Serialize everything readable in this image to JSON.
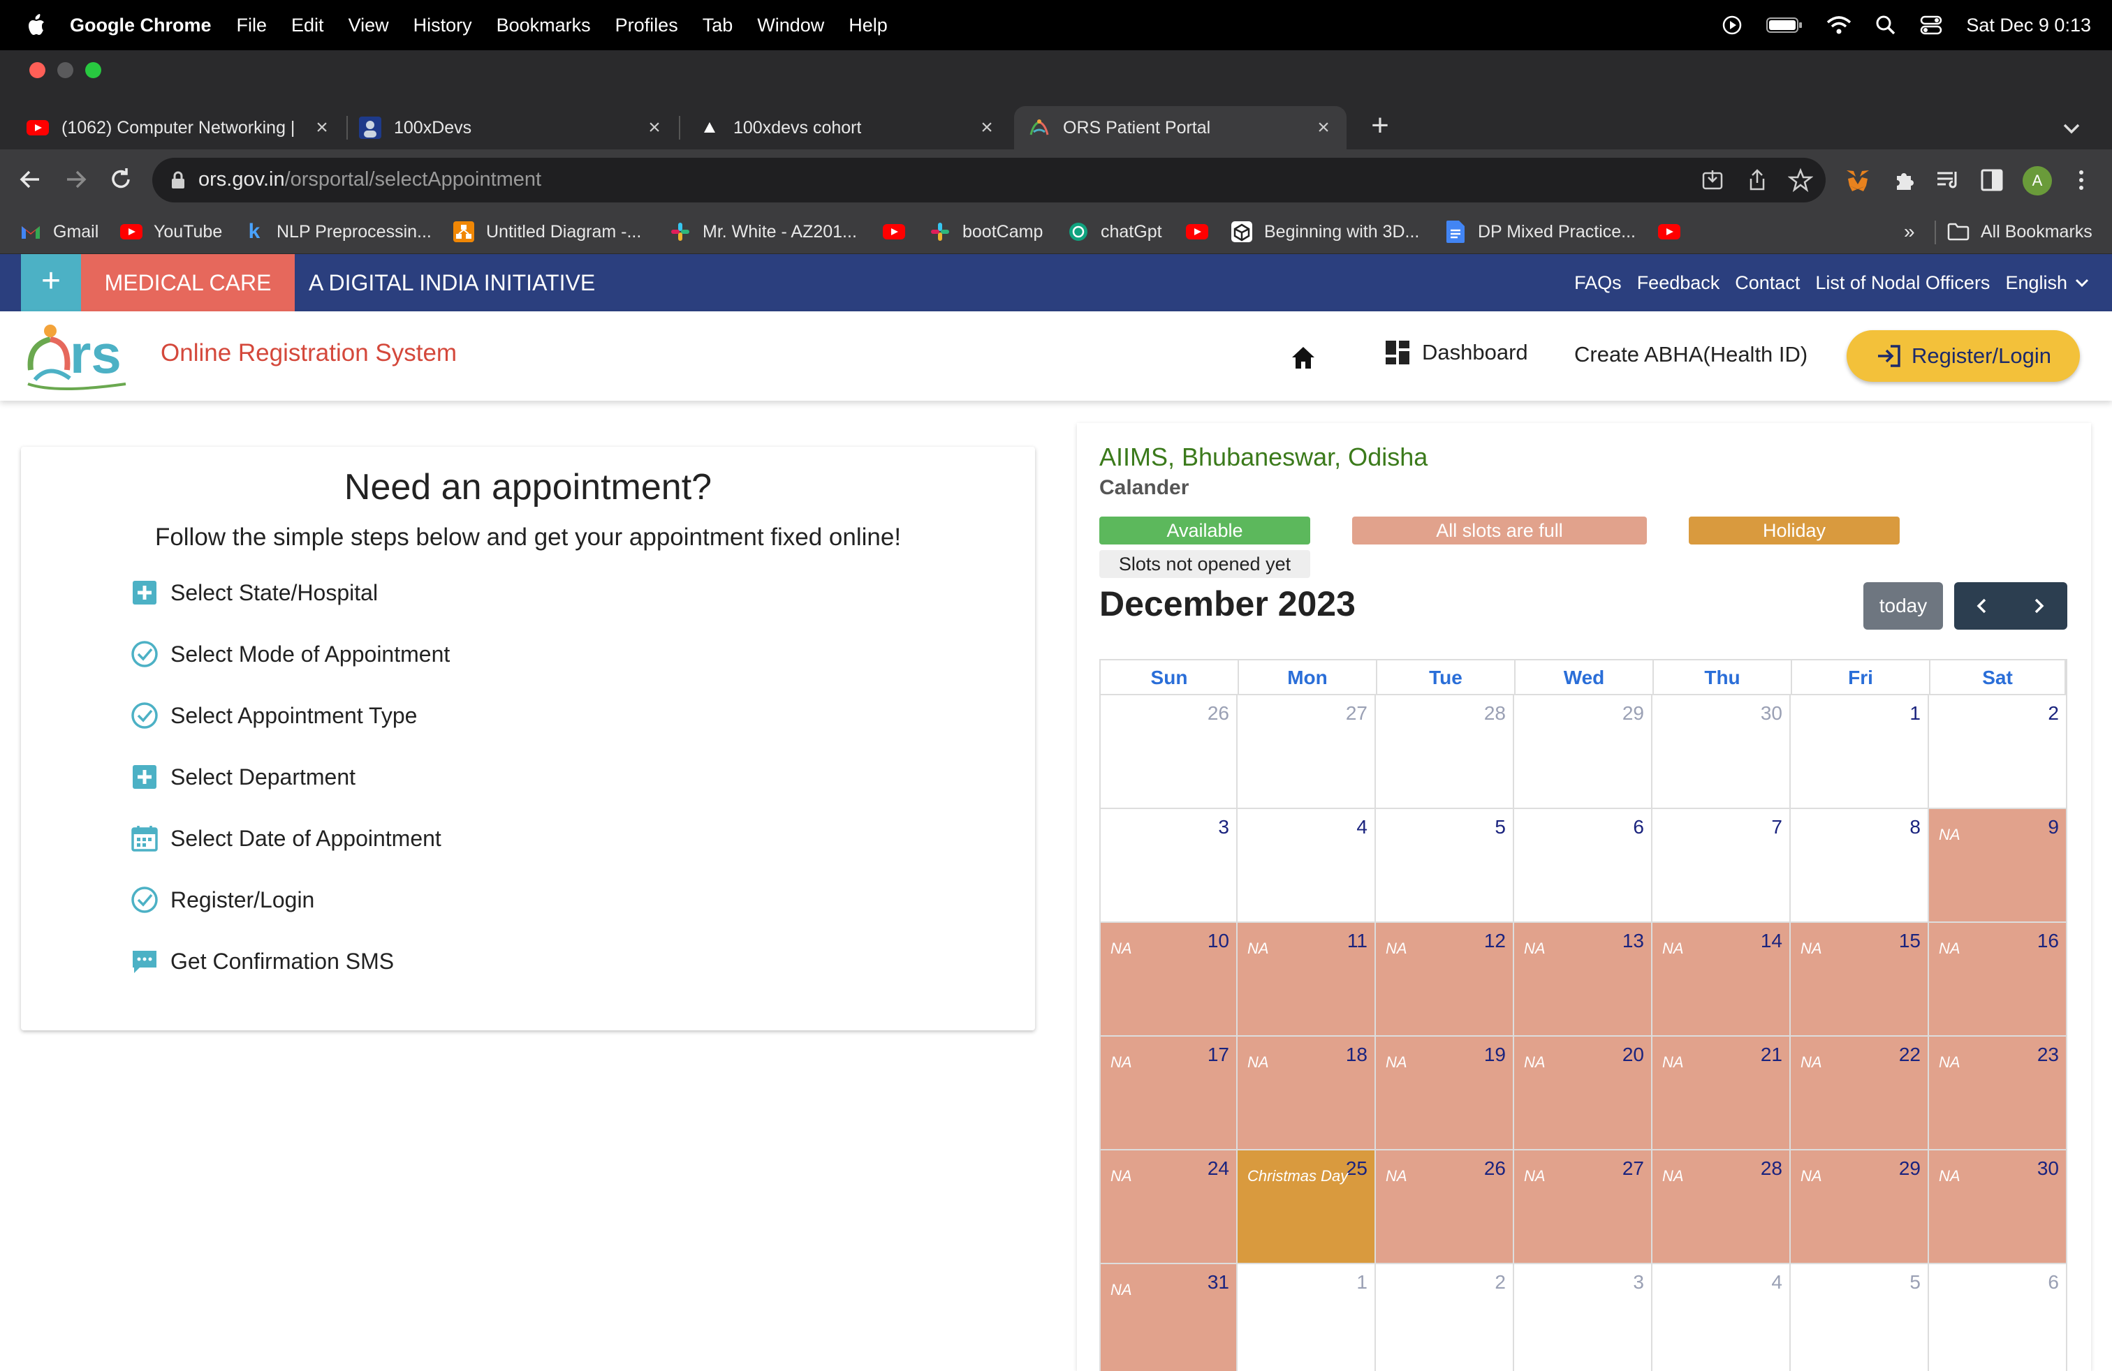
{
  "os_menubar": {
    "app_name": "Google Chrome",
    "menus": [
      "File",
      "Edit",
      "View",
      "History",
      "Bookmarks",
      "Profiles",
      "Tab",
      "Window",
      "Help"
    ],
    "clock": "Sat Dec 9  0:13"
  },
  "browser": {
    "tabs": [
      {
        "title": "(1062) Computer Networking |",
        "icon": "youtube-icon"
      },
      {
        "title": "100xDevs",
        "icon": "avatar-icon"
      },
      {
        "title": "100xdevs cohort",
        "icon": "triangle-icon"
      },
      {
        "title": "ORS Patient Portal",
        "icon": "ors-icon"
      }
    ],
    "url_host": "ors.gov.in",
    "url_path": "/orsportal/selectAppointment",
    "profile_initial": "A",
    "bookmarks": [
      {
        "label": "Gmail",
        "icon": "gmail-icon"
      },
      {
        "label": "YouTube",
        "icon": "youtube-icon"
      },
      {
        "label": "NLP Preprocessin...",
        "icon": "k-icon"
      },
      {
        "label": "Untitled Diagram -...",
        "icon": "drawio-icon"
      },
      {
        "label": "Mr. White - AZ201...",
        "icon": "slack-icon"
      },
      {
        "label": "",
        "icon": "youtube-icon"
      },
      {
        "label": "bootCamp",
        "icon": "slack-icon"
      },
      {
        "label": "chatGpt",
        "icon": "chatgpt-icon"
      },
      {
        "label": "",
        "icon": "youtube-icon"
      },
      {
        "label": "Beginning with 3D...",
        "icon": "unity-icon"
      },
      {
        "label": "DP Mixed Practice...",
        "icon": "docs-icon"
      },
      {
        "label": "",
        "icon": "youtube-icon"
      }
    ],
    "bookmarks_overflow": "»",
    "all_bookmarks": "All Bookmarks"
  },
  "site": {
    "topbar": {
      "plus": "+",
      "medical_care": "MEDICAL CARE",
      "initiative": "A DIGITAL INDIA INITIATIVE",
      "links": [
        "FAQs",
        "Feedback",
        "Contact",
        "List of Nodal Officers"
      ],
      "language": "English"
    },
    "header": {
      "brand": "Online Registration System",
      "dashboard": "Dashboard",
      "abha": "Create ABHA(Health ID)",
      "register_login": "Register/Login"
    },
    "appointment_card": {
      "title": "Need an appointment?",
      "subtitle": "Follow the simple steps below and get your appointment fixed online!",
      "steps": [
        {
          "label": "Select State/Hospital",
          "icon": "plus-square-icon"
        },
        {
          "label": "Select Mode of Appointment",
          "icon": "check-circle-icon"
        },
        {
          "label": "Select Appointment Type",
          "icon": "check-circle-icon"
        },
        {
          "label": "Select Department",
          "icon": "plus-square-icon"
        },
        {
          "label": "Select Date of Appointment",
          "icon": "calendar-icon"
        },
        {
          "label": "Register/Login",
          "icon": "check-circle-icon"
        },
        {
          "label": "Get Confirmation SMS",
          "icon": "sms-icon"
        }
      ]
    },
    "calendar": {
      "hospital": "AIIMS, Bhubaneswar, Odisha",
      "caption": "Calander",
      "legend": [
        {
          "label": "Available",
          "color": "#5cb85c"
        },
        {
          "label": "All slots are full",
          "color": "#e1a28c"
        },
        {
          "label": "Holiday",
          "color": "#d99a3e"
        },
        {
          "label": "Slots not opened yet",
          "color": "#eeeeee"
        }
      ],
      "month_title": "December 2023",
      "today": "today",
      "weekdays": [
        "Sun",
        "Mon",
        "Tue",
        "Wed",
        "Thu",
        "Fri",
        "Sat"
      ],
      "na_label": "NA",
      "weeks": [
        [
          {
            "d": "26",
            "s": "other"
          },
          {
            "d": "27",
            "s": "other"
          },
          {
            "d": "28",
            "s": "other"
          },
          {
            "d": "29",
            "s": "other"
          },
          {
            "d": "30",
            "s": "other"
          },
          {
            "d": "1",
            "s": "open"
          },
          {
            "d": "2",
            "s": "open"
          }
        ],
        [
          {
            "d": "3",
            "s": "open"
          },
          {
            "d": "4",
            "s": "open"
          },
          {
            "d": "5",
            "s": "open"
          },
          {
            "d": "6",
            "s": "open"
          },
          {
            "d": "7",
            "s": "open"
          },
          {
            "d": "8",
            "s": "open"
          },
          {
            "d": "9",
            "s": "full"
          }
        ],
        [
          {
            "d": "10",
            "s": "full"
          },
          {
            "d": "11",
            "s": "full"
          },
          {
            "d": "12",
            "s": "full"
          },
          {
            "d": "13",
            "s": "full"
          },
          {
            "d": "14",
            "s": "full"
          },
          {
            "d": "15",
            "s": "full"
          },
          {
            "d": "16",
            "s": "full"
          }
        ],
        [
          {
            "d": "17",
            "s": "full"
          },
          {
            "d": "18",
            "s": "full"
          },
          {
            "d": "19",
            "s": "full"
          },
          {
            "d": "20",
            "s": "full"
          },
          {
            "d": "21",
            "s": "full"
          },
          {
            "d": "22",
            "s": "full"
          },
          {
            "d": "23",
            "s": "full"
          }
        ],
        [
          {
            "d": "24",
            "s": "full"
          },
          {
            "d": "25",
            "s": "holiday",
            "label": "Christmas Day"
          },
          {
            "d": "26",
            "s": "full"
          },
          {
            "d": "27",
            "s": "full"
          },
          {
            "d": "28",
            "s": "full"
          },
          {
            "d": "29",
            "s": "full"
          },
          {
            "d": "30",
            "s": "full"
          }
        ],
        [
          {
            "d": "31",
            "s": "full"
          },
          {
            "d": "1",
            "s": "other"
          },
          {
            "d": "2",
            "s": "other"
          },
          {
            "d": "3",
            "s": "other"
          },
          {
            "d": "4",
            "s": "other"
          },
          {
            "d": "5",
            "s": "other"
          },
          {
            "d": "6",
            "s": "other"
          }
        ]
      ]
    }
  }
}
